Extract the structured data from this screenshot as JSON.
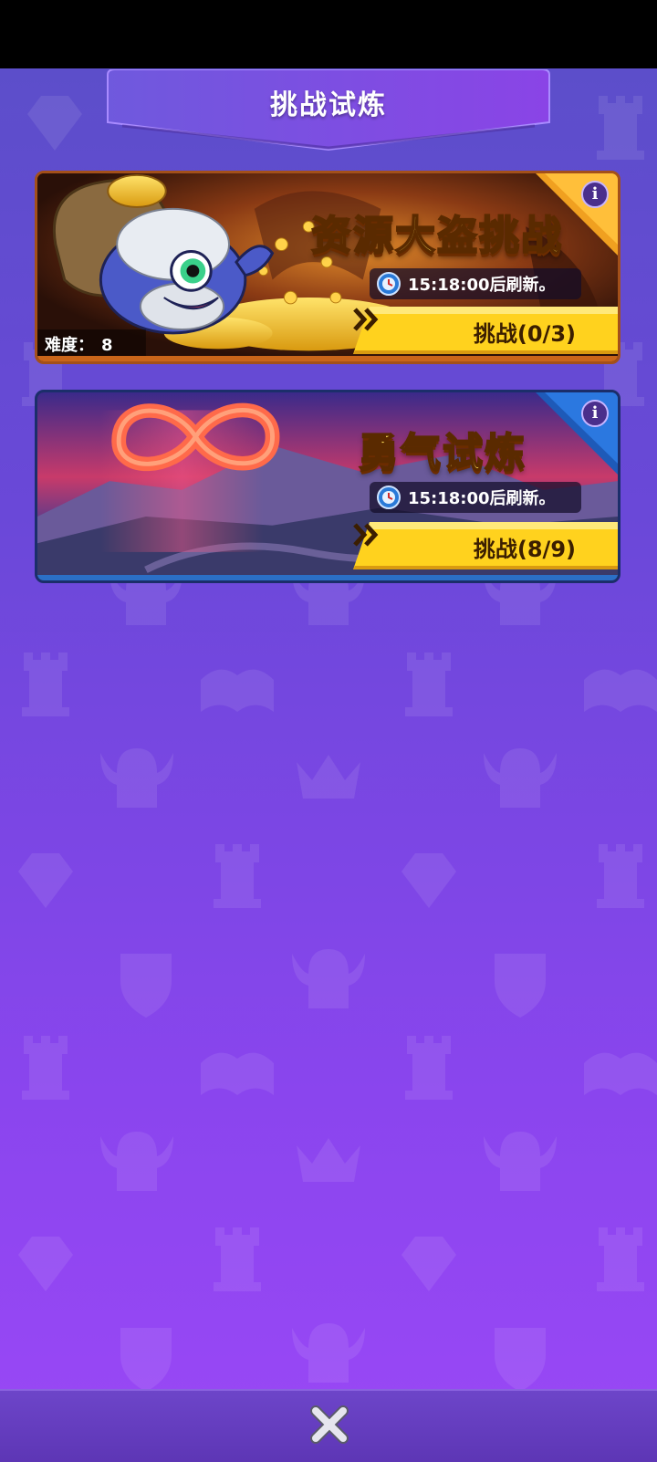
{
  "header": {
    "title": "挑战试炼"
  },
  "cards": [
    {
      "title": "资源大盗挑战",
      "timer": "15:18:00后刷新。",
      "challenge_label": "挑战(0/3)",
      "difficulty_label": "难度：",
      "difficulty_value": "8",
      "info_icon": "i",
      "accent": "#f0a020"
    },
    {
      "title": "勇气试炼",
      "timer": "15:18:00后刷新。",
      "challenge_label": "挑战(8/9)",
      "info_icon": "i",
      "accent": "#2b6fc6"
    }
  ],
  "footer": {
    "close_icon": "close-icon"
  },
  "colors": {
    "background": "#7a46e6",
    "button_yellow": "#ffd21e"
  }
}
